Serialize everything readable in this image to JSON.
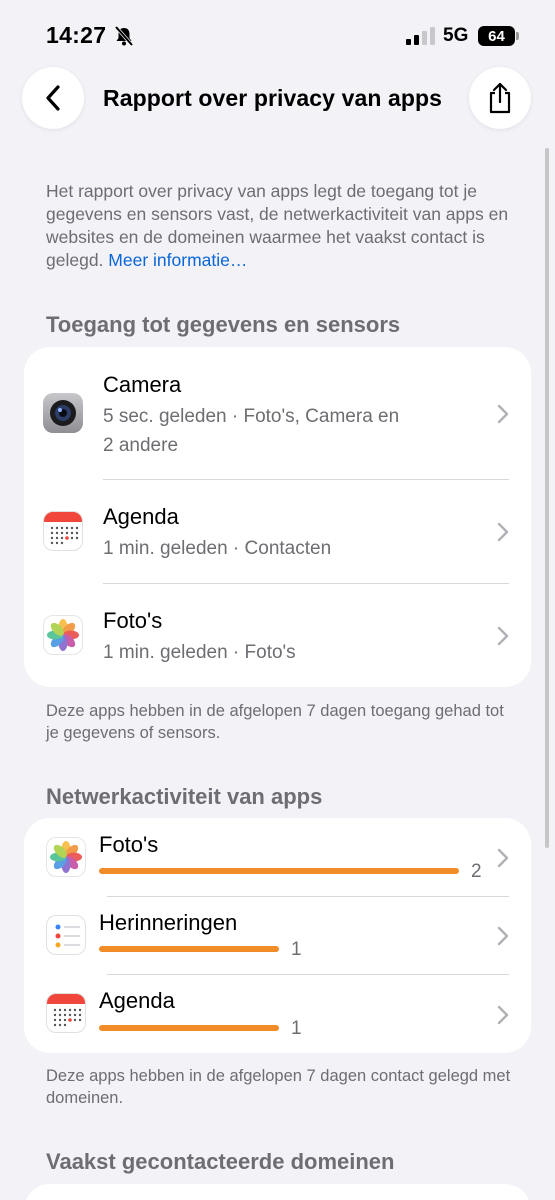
{
  "status": {
    "time": "14:27",
    "network": "5G",
    "battery": "64"
  },
  "nav": {
    "title": "Rapport over privacy van apps"
  },
  "intro": {
    "text": "Het rapport over privacy van apps legt de toegang tot je gegevens en sensors vast, de netwerkactiviteit van apps en websites en de domeinen waarmee het vaakst contact is gelegd.",
    "link": "Meer informatie…"
  },
  "access": {
    "header": "Toegang tot gegevens en sensors",
    "items": [
      {
        "title": "Camera",
        "subtitle_line1": "5 sec. geleden · Foto's, Camera en",
        "subtitle_line2": "2 andere",
        "icon": "camera-icon"
      },
      {
        "title": "Agenda",
        "subtitle_line1": "1 min. geleden · Contacten",
        "icon": "calendar-icon"
      },
      {
        "title": "Foto's",
        "subtitle_line1": "1 min. geleden · Foto's",
        "icon": "photos-icon"
      }
    ],
    "footer": "Deze apps hebben in de afgelopen 7 dagen toegang gehad tot je gegevens of sensors."
  },
  "network": {
    "header": "Netwerkactiviteit van apps",
    "items": [
      {
        "title": "Foto's",
        "count": 2,
        "count_label": "2",
        "icon": "photos-icon"
      },
      {
        "title": "Herinneringen",
        "count": 1,
        "count_label": "1",
        "icon": "reminders-icon"
      },
      {
        "title": "Agenda",
        "count": 1,
        "count_label": "1",
        "icon": "calendar-icon"
      }
    ],
    "footer": "Deze apps hebben in de afgelopen 7 dagen contact gelegd met domeinen."
  },
  "domains": {
    "header": "Vaakst gecontacteerde domeinen"
  },
  "colors": {
    "accent": "#0a66d8",
    "bar": "#f28c28",
    "background": "#f2f2f7"
  }
}
